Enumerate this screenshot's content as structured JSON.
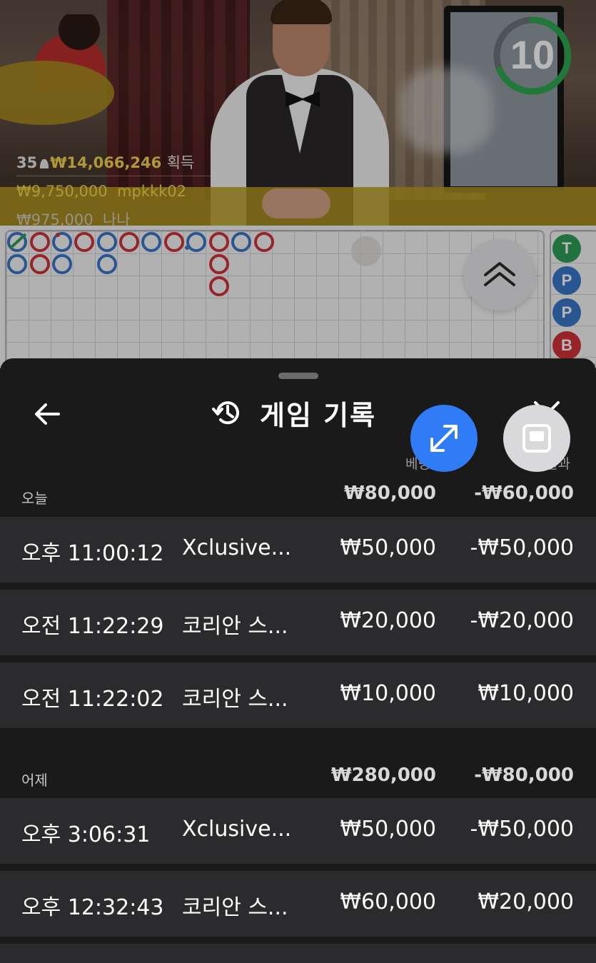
{
  "live": {
    "stats": {
      "players": "35",
      "total": "₩14,066,246",
      "total_suffix": "획득",
      "winner1_amount": "₩9,750,000",
      "winner1_name": "mpkkk02",
      "winner2_amount": "₩975,000",
      "winner2_name": "나나"
    },
    "timer": "10"
  },
  "roadmap": {
    "bead_labels": [
      "T",
      "P",
      "P",
      "B"
    ]
  },
  "sheet": {
    "title": "게임 기록",
    "icons": [
      "back-arrow-icon",
      "history-icon",
      "close-icon",
      "expand-icon",
      "picture-in-picture-icon"
    ],
    "col_bet": "베팅",
    "col_result": "결과",
    "groups": [
      {
        "label": "오늘",
        "bet": "₩80,000",
        "result": "-₩60,000",
        "records": [
          {
            "time": "오후 11:00:12",
            "game": "Xclusive...",
            "bet": "₩50,000",
            "result": "-₩50,000"
          },
          {
            "time": "오전 11:22:29",
            "game": "코리안 스...",
            "bet": "₩20,000",
            "result": "-₩20,000"
          },
          {
            "time": "오전 11:22:02",
            "game": "코리안 스...",
            "bet": "₩10,000",
            "result": "₩10,000"
          }
        ]
      },
      {
        "label": "어제",
        "bet": "₩280,000",
        "result": "-₩80,000",
        "records": [
          {
            "time": "오후 3:06:31",
            "game": "Xclusive...",
            "bet": "₩50,000",
            "result": "-₩50,000"
          },
          {
            "time": "오후 12:32:43",
            "game": "코리안 스...",
            "bet": "₩60,000",
            "result": "₩20,000"
          }
        ]
      }
    ]
  },
  "colors": {
    "banker_red": "#d0323a",
    "player_blue": "#3a78c9",
    "tie_green": "#2f9e57",
    "accent_blue": "#2f7cf6",
    "gold_text": "#f0d54e"
  }
}
